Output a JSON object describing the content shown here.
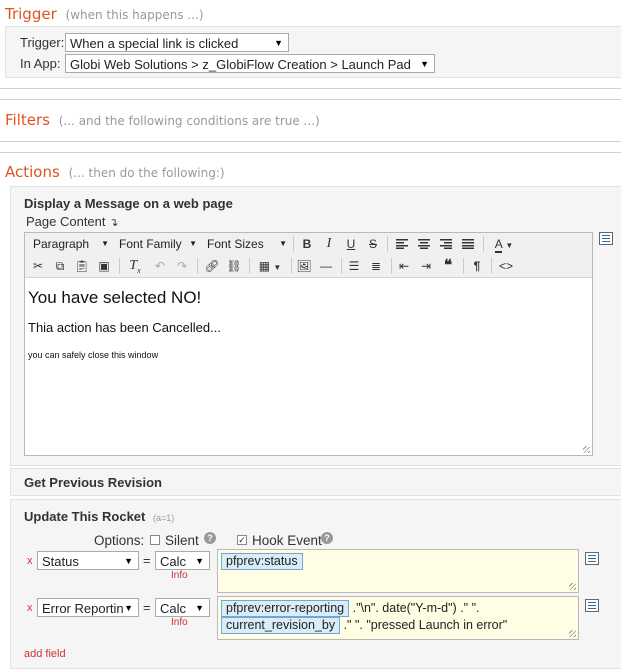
{
  "trigger": {
    "title": "Trigger",
    "hint": "(when this happens ...)",
    "trigger_label": "Trigger:",
    "trigger_value": "When a special link is clicked",
    "inapp_label": "In App:",
    "inapp_value": "Globi Web Solutions > z_GlobiFlow Creation > Launch Pad"
  },
  "filters": {
    "title": "Filters",
    "hint": "(... and the following conditions are true ...)"
  },
  "actions": {
    "title": "Actions",
    "hint": "(... then do the following:)"
  },
  "display_message": {
    "title": "Display a Message on a web page",
    "page_content_label": "Page Content",
    "toolbar": {
      "paragraph": "Paragraph",
      "font_family": "Font Family",
      "font_sizes": "Font Sizes",
      "bold": "B",
      "italic": "I",
      "underline": "U",
      "strike": "S",
      "text_color": "A",
      "source": "<>"
    },
    "content": {
      "heading": "You have selected NO!",
      "line1": "Thia action has been Cancelled...",
      "line2": "you can safely close this window"
    }
  },
  "get_previous_revision": {
    "title": "Get Previous Revision"
  },
  "update_rocket": {
    "title": "Update This Rocket",
    "count": "(a=1)",
    "options_label": "Options:",
    "silent_label": "Silent",
    "silent_checked": false,
    "hook_label": "Hook Event",
    "hook_checked": true,
    "rows": [
      {
        "field": "Status",
        "mode": "Calc",
        "info": "Info",
        "tokens": [
          "pfprev:status"
        ],
        "text": ""
      },
      {
        "field": "Error Reporting",
        "mode": "Calc",
        "info": "Info",
        "token1": "pfprev:error-reporting",
        "text1": ".\"\\n\". date(\"Y-m-d\") .\" \".",
        "token2": "current_revision_by",
        "text2": ".\" \". \"pressed Launch in error\""
      }
    ],
    "add_field": "add field"
  },
  "icons": {
    "dropdown": "chevron-down-icon",
    "field_list": "field-list-icon",
    "help": "help-icon",
    "remove": "remove-icon",
    "resize": "resize-grip-icon"
  },
  "colors": {
    "section_title": "#e0541f",
    "token_bg": "#d9ecf7",
    "token_border": "#6fa8d0",
    "calc_area": "#fffde3",
    "remove": "#dd3333"
  }
}
